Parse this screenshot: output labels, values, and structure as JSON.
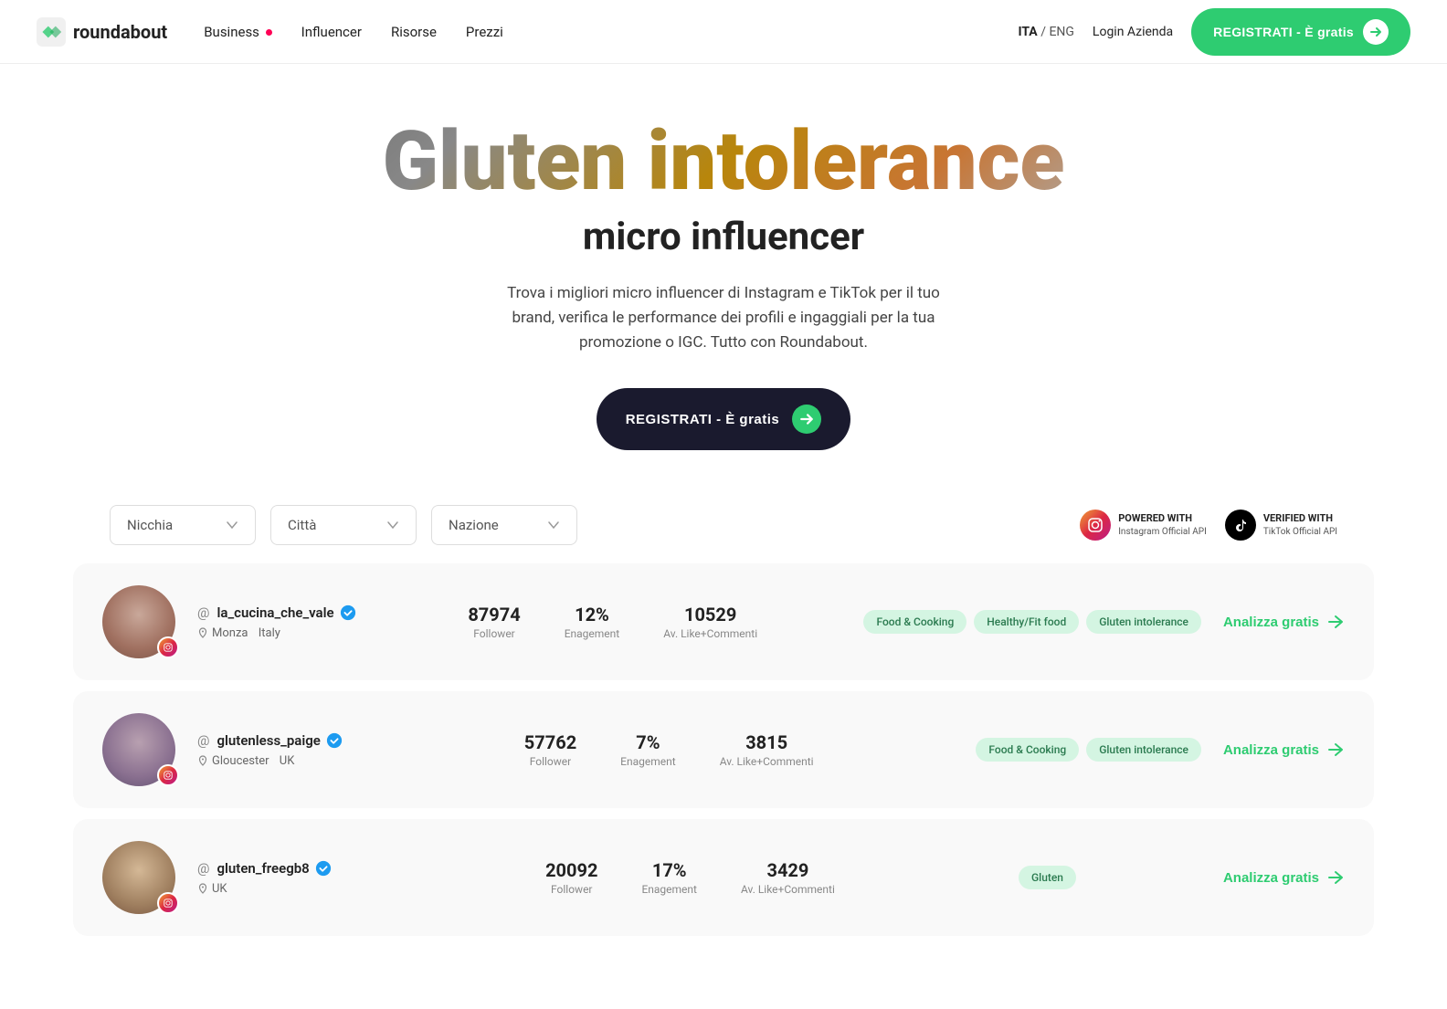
{
  "nav": {
    "logo_text": "roundabout",
    "links": [
      {
        "label": "Business",
        "dot": true
      },
      {
        "label": "Influencer",
        "dot": false
      },
      {
        "label": "Risorse",
        "dot": false
      },
      {
        "label": "Prezzi",
        "dot": false
      }
    ],
    "lang_ita": "ITA",
    "lang_sep": "/",
    "lang_eng": "ENG",
    "login": "Login Azienda",
    "register": "REGISTRATI - È gratis"
  },
  "hero": {
    "title": "Gluten intolerance",
    "subtitle": "micro influencer",
    "desc": "Trova i migliori micro influencer di Instagram e TikTok per il tuo brand, verifica le performance dei profili e ingaggiali per la tua promozione o IGC. Tutto con Roundabout.",
    "cta": "REGISTRATI - È gratis"
  },
  "filters": {
    "nicchia": "Nicchia",
    "citta": "Città",
    "nazione": "Nazione",
    "badge_ig_label": "POWERED WITH",
    "badge_ig_api": "Instagram Official API",
    "badge_tt_label": "VERIFIED WITH",
    "badge_tt_api": "TikTok Official API"
  },
  "influencers": [
    {
      "handle": "la_cucina_che_vale",
      "verified": true,
      "city": "Monza",
      "country": "Italy",
      "followers": "87974",
      "engagement": "12%",
      "avg": "10529",
      "tags": [
        "Food & Cooking",
        "Healthy/Fit food",
        "Gluten intolerance"
      ],
      "cta": "Analizza gratis"
    },
    {
      "handle": "glutenless_paige",
      "verified": true,
      "city": "Gloucester",
      "country": "UK",
      "followers": "57762",
      "engagement": "7%",
      "avg": "3815",
      "tags": [
        "Food & Cooking",
        "Gluten intolerance"
      ],
      "cta": "Analizza gratis"
    },
    {
      "handle": "gluten_freegb8",
      "verified": true,
      "city": "",
      "country": "UK",
      "followers": "20092",
      "engagement": "17%",
      "avg": "3429",
      "tags": [
        "Gluten"
      ],
      "cta": "Analizza gratis"
    }
  ],
  "labels": {
    "follower": "Follower",
    "engagement": "Enagement",
    "avg_label": "Av. Like+Commenti",
    "at": "@",
    "sep": "/"
  }
}
